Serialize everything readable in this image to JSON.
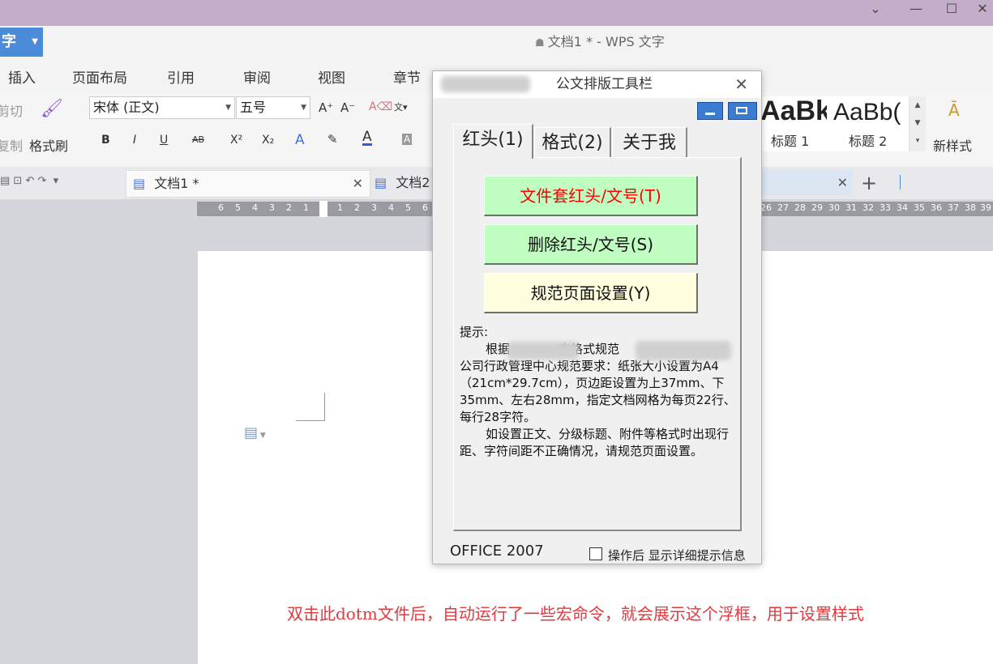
{
  "window": {
    "doc_title": "文档1 * - WPS 文字",
    "app_button": "字"
  },
  "menu": [
    "插入",
    "页面布局",
    "引用",
    "审阅",
    "视图",
    "章节"
  ],
  "ribbon": {
    "cut": "剪切",
    "copy": "复制",
    "format_painter": "格式刷",
    "font_name": "宋体 (正文)",
    "font_size": "五号",
    "bold": "B",
    "italic": "I",
    "underline": "U",
    "strike": "AB",
    "superscript": "X²",
    "subscript": "X₂",
    "style_sample_1": "AaBk",
    "style_label_1": "标题 1",
    "style_sample_2": "AaBb(",
    "style_label_2": "标题 2",
    "new_style": "新样式"
  },
  "doc_tabs": [
    {
      "label": "文档1 *"
    },
    {
      "label": "文档2"
    }
  ],
  "ruler": {
    "left_numbers": [
      "6",
      "5",
      "4",
      "3",
      "2",
      "1"
    ],
    "right_numbers": [
      "1",
      "2",
      "3",
      "4",
      "5",
      "6"
    ],
    "far_numbers": [
      "26",
      "27",
      "28",
      "29",
      "30",
      "31",
      "32",
      "33",
      "34",
      "35",
      "36",
      "37",
      "38",
      "39"
    ]
  },
  "dialog": {
    "title": "公文排版工具栏",
    "tabs": [
      "红头(1)",
      "格式(2)",
      "关于我"
    ],
    "buttons": {
      "apply_header": "文件套红头/文号(T)",
      "delete_header": "删除红头/文号(S)",
      "page_setup": "规范页面设置(Y)"
    },
    "hint": {
      "label": "提示:",
      "line1_a": "根据",
      "line1_b": "文格式规范",
      "body": "公司行政管理中心规范要求：纸张大小设置为A4（21cm*29.7cm），页边距设置为上37mm、下35mm、左右28mm，指定文档网格为每页22行、每行28字符。",
      "para2": "如设置正文、分级标题、附件等格式时出现行距、字符间距不正确情况，请规范页面设置。"
    },
    "version": "OFFICE 2007",
    "checkbox_label": "操作后 显示详细提示信息",
    "checkbox_checked": false
  },
  "annotation": "双击此dotm文件后，自动运行了一些宏命令，就会展示这个浮框，用于设置样式",
  "colors": {
    "red_text": "#e0393e",
    "green_button": "#c0fdc0",
    "yellow_button": "#ffffe0",
    "title_bar": "#c3adc9",
    "app_blue": "#4b8bd8"
  }
}
